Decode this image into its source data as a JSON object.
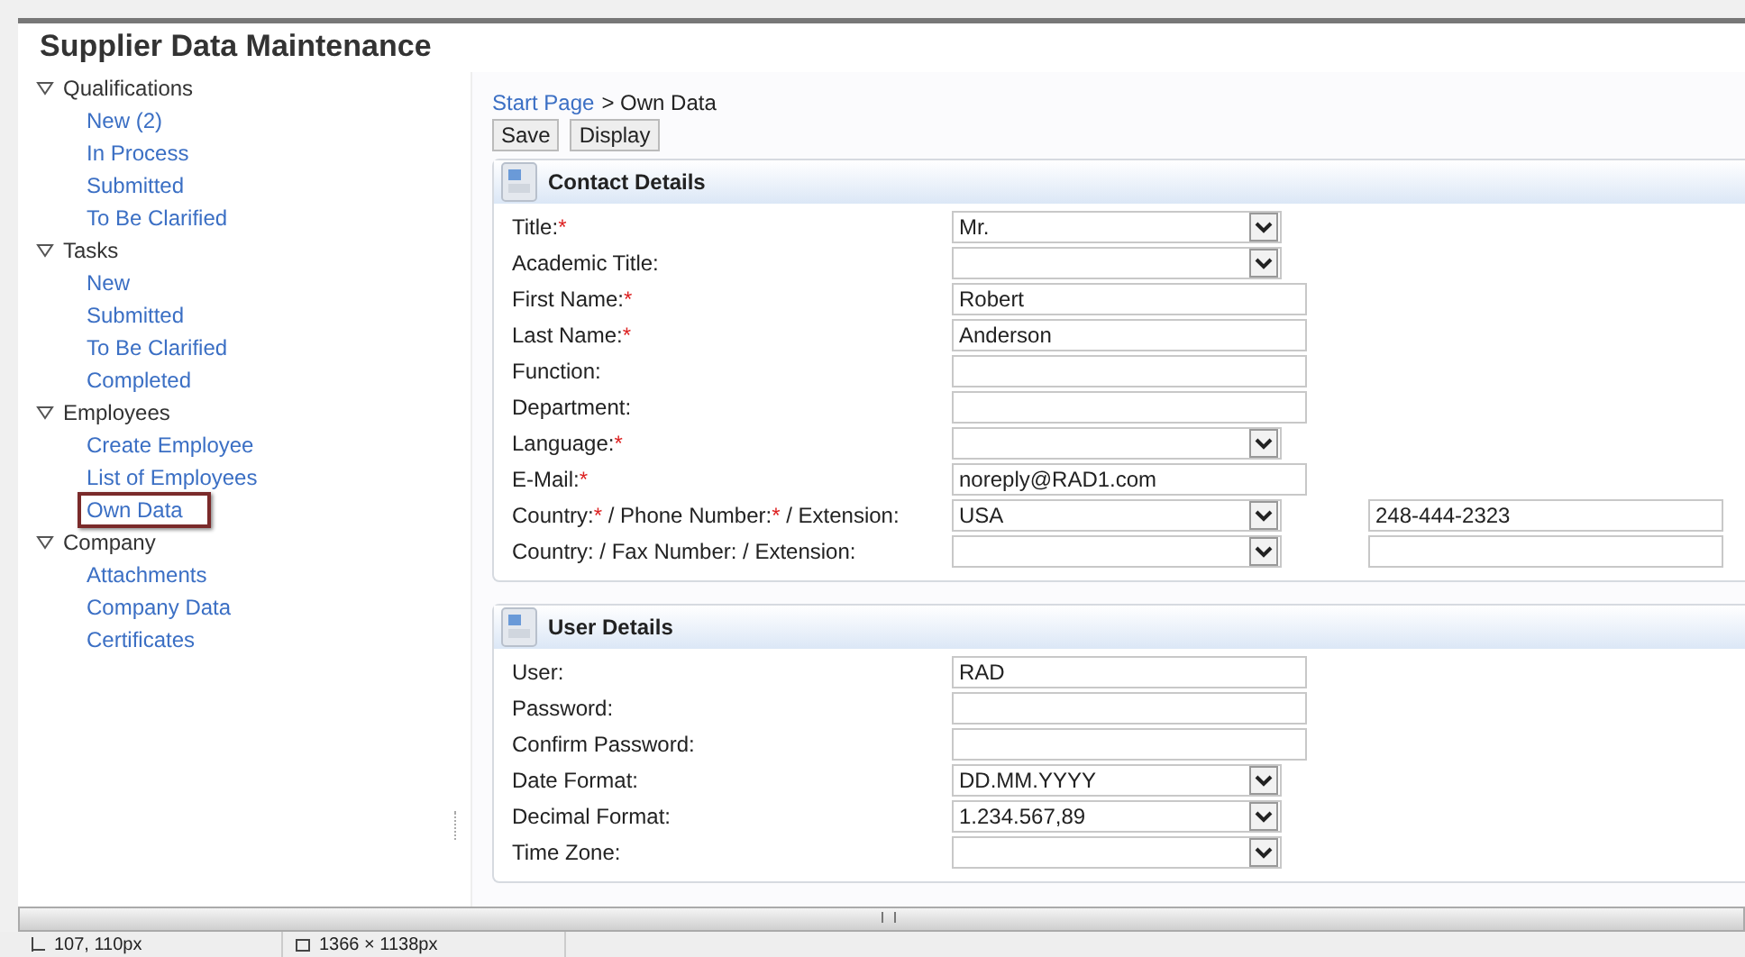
{
  "page_title": "Supplier Data Maintenance",
  "sidebar": {
    "groups": [
      {
        "label": "Qualifications",
        "expanded": true,
        "items": [
          {
            "label": "New (2)",
            "selected": false
          },
          {
            "label": "In Process",
            "selected": false
          },
          {
            "label": "Submitted",
            "selected": false
          },
          {
            "label": "To Be Clarified",
            "selected": false
          }
        ]
      },
      {
        "label": "Tasks",
        "expanded": true,
        "items": [
          {
            "label": "New",
            "selected": false
          },
          {
            "label": "Submitted",
            "selected": false
          },
          {
            "label": "To Be Clarified",
            "selected": false
          },
          {
            "label": "Completed",
            "selected": false
          }
        ]
      },
      {
        "label": "Employees",
        "expanded": true,
        "items": [
          {
            "label": "Create Employee",
            "selected": false
          },
          {
            "label": "List of Employees",
            "selected": false
          },
          {
            "label": "Own Data",
            "selected": true
          }
        ]
      },
      {
        "label": "Company",
        "expanded": true,
        "items": [
          {
            "label": "Attachments",
            "selected": false
          },
          {
            "label": "Company Data",
            "selected": false
          },
          {
            "label": "Certificates",
            "selected": false
          }
        ]
      }
    ]
  },
  "breadcrumb": {
    "link": "Start Page",
    "separator": ">",
    "current": "Own Data"
  },
  "buttons": [
    "Save",
    "Display"
  ],
  "panels": [
    {
      "title": "Contact Details",
      "rows": [
        {
          "label": [
            {
              "text": "Title:"
            },
            {
              "text": "*",
              "required": true
            }
          ],
          "kind": "select",
          "value": "Mr."
        },
        {
          "label": [
            {
              "text": "Academic Title:"
            }
          ],
          "kind": "select"
        },
        {
          "label": [
            {
              "text": "First Name:"
            },
            {
              "text": "*",
              "required": true
            }
          ],
          "kind": "text",
          "value": "Robert"
        },
        {
          "label": [
            {
              "text": "Last Name:"
            },
            {
              "text": "*",
              "required": true
            }
          ],
          "kind": "text",
          "value": "Anderson"
        },
        {
          "label": [
            {
              "text": "Function:"
            }
          ],
          "kind": "text"
        },
        {
          "label": [
            {
              "text": "Department:"
            }
          ],
          "kind": "text"
        },
        {
          "label": [
            {
              "text": "Language:"
            },
            {
              "text": "*",
              "required": true
            }
          ],
          "kind": "select"
        },
        {
          "label": [
            {
              "text": "E-Mail:"
            },
            {
              "text": "*",
              "required": true
            }
          ],
          "kind": "text",
          "value": "noreply@RAD1.com"
        },
        {
          "label": [
            {
              "text": "Country:"
            },
            {
              "text": "*",
              "required": true
            },
            {
              "text": " / Phone Number:"
            },
            {
              "text": "*",
              "required": true
            },
            {
              "text": " / Extension:"
            }
          ],
          "kind": "select",
          "value": "USA",
          "extra": {
            "kind": "text",
            "value": "248-444-2323"
          }
        },
        {
          "label": [
            {
              "text": "Country: / Fax Number: / Extension:"
            }
          ],
          "kind": "select",
          "extra": {
            "kind": "text"
          }
        }
      ]
    },
    {
      "title": "User Details",
      "rows": [
        {
          "label": [
            {
              "text": "User:"
            }
          ],
          "kind": "text",
          "value": "RAD"
        },
        {
          "label": [
            {
              "text": "Password:"
            }
          ],
          "kind": "text"
        },
        {
          "label": [
            {
              "text": "Confirm Password:"
            }
          ],
          "kind": "text"
        },
        {
          "label": [
            {
              "text": "Date Format:"
            }
          ],
          "kind": "select",
          "value": "DD.MM.YYYY"
        },
        {
          "label": [
            {
              "text": "Decimal Format:"
            }
          ],
          "kind": "select",
          "value": "1.234.567,89"
        },
        {
          "label": [
            {
              "text": "Time Zone:"
            }
          ],
          "kind": "select"
        }
      ]
    }
  ],
  "status_bar": [
    "107, 110px",
    "1366 × 1138px"
  ]
}
